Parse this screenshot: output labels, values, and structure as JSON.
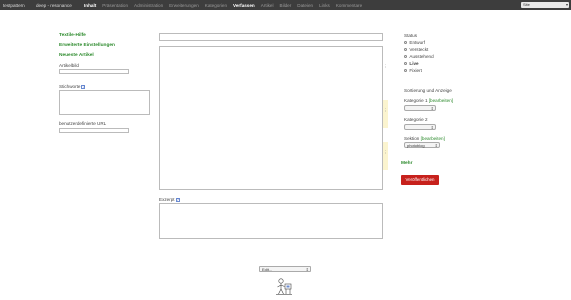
{
  "topbar": {
    "site": "testpattern",
    "subsite": "deep - resonance",
    "tabs": [
      {
        "label": "Inhalt",
        "state": "active"
      },
      {
        "label": "Präsentation",
        "state": "normal"
      },
      {
        "label": "Administration",
        "state": "normal"
      },
      {
        "label": "Erweiterungen",
        "state": "normal"
      },
      {
        "label": "Kategorien",
        "state": "normal"
      },
      {
        "label": "Verfassen",
        "state": "bold"
      },
      {
        "label": "Artikel",
        "state": "normal"
      },
      {
        "label": "Bilder",
        "state": "normal"
      },
      {
        "label": "Dateien",
        "state": "normal"
      },
      {
        "label": "Links",
        "state": "normal"
      },
      {
        "label": "Kommentare",
        "state": "normal"
      }
    ],
    "right_select": "Site"
  },
  "left": {
    "textile_help": "Textile-Hilfe",
    "advanced": "Erweiterte Einstellungen",
    "recent": "Neueste Artikel",
    "article_image_label": "Artikelbild",
    "keywords_label": "Stichworte",
    "keywords_help": "?",
    "custom_url_label": "benutzerdefinierte URL"
  },
  "main": {
    "excerpt_label": "Exzerpt",
    "excerpt_help": "?"
  },
  "right": {
    "status_label": "Status",
    "status_options": [
      {
        "label": "Entwurf",
        "selected": false
      },
      {
        "label": "Versteckt",
        "selected": false
      },
      {
        "label": "Ausstehend",
        "selected": false
      },
      {
        "label": "Live",
        "selected": true
      },
      {
        "label": "Fixiert",
        "selected": false
      }
    ],
    "sort_label": "Sortierung und Anzeige",
    "category1_label": "Kategorie 1",
    "category1_edit": "[bearbeiten]",
    "category2_label": "Kategorie 2",
    "section_label": "Sektion",
    "section_edit": "[bearbeiten]",
    "section_value": "photoblog",
    "more": "Mehr",
    "publish": "Veröffentlichen"
  },
  "footer": {
    "select_value": "Edit..."
  },
  "colors": {
    "accent_green": "#2e8b2e",
    "publish_red": "#c7211c",
    "topbar": "#3d3d3d"
  }
}
